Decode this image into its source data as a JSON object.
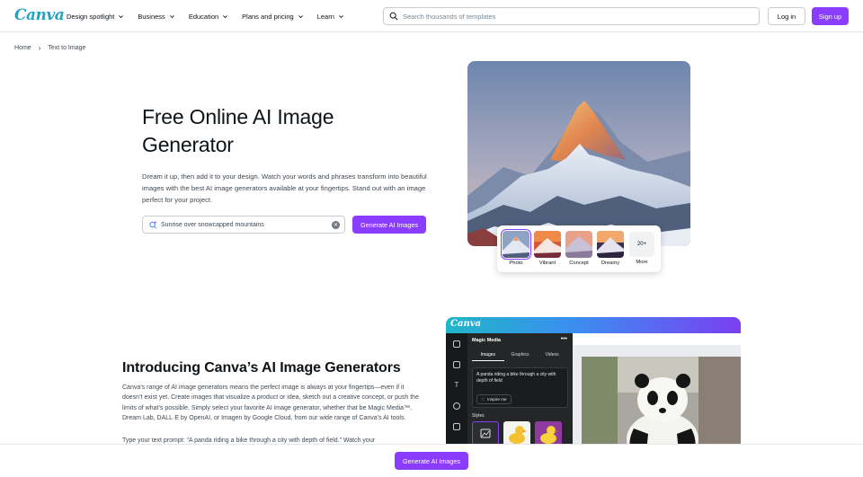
{
  "nav": {
    "logo": "Canva",
    "menu": [
      {
        "label": "Design spotlight"
      },
      {
        "label": "Business"
      },
      {
        "label": "Education"
      },
      {
        "label": "Plans and pricing"
      },
      {
        "label": "Learn"
      }
    ],
    "search_placeholder": "Search thousands of templates",
    "login_label": "Log in",
    "signup_label": "Sign up"
  },
  "breadcrumb": {
    "home": "Home",
    "current": "Text to Image"
  },
  "hero": {
    "title": "Free Online AI Image Generator",
    "description": "Dream it up, then add it to your design. Watch your words and phrases transform into beautiful images with the best AI image generators available at your fingertips. Stand out with an image perfect for your project.",
    "prompt_value": "Sunrise over snowcapped mountains",
    "generate_label": "Generate AI Images",
    "styles": [
      {
        "label": "Photo",
        "selected": true
      },
      {
        "label": "Vibrant",
        "selected": false
      },
      {
        "label": "Concept",
        "selected": false
      },
      {
        "label": "Dreamy",
        "selected": false
      },
      {
        "label": "More",
        "badge": "20+",
        "selected": false
      }
    ]
  },
  "intro": {
    "title": "Introducing Canva’s AI Image Generators",
    "paragraph": "Canva’s range of AI image generators means the perfect image is always at your fingertips—even if it doesn’t exist yet. Create images that visualize a product or idea, sketch out a creative concept, or push the limits of what’s possible. Simply select your favorite AI image generator, whether that be Magic Media™, Dream Lab, DALL·E by OpenAI, or Imagen by Google Cloud, from our wide range of Canva’s AI tools.",
    "paragraph2": "Type your text prompt: “A panda riding a bike through a city with depth of field.” Watch your"
  },
  "editor": {
    "logo": "Canva",
    "panel_title": "Magic Media",
    "menu_dots": "•••",
    "tabs": [
      {
        "label": "Images",
        "active": true
      },
      {
        "label": "Graphics",
        "active": false
      },
      {
        "label": "Videos",
        "active": false
      }
    ],
    "prompt_text": "A panda riding a bike through a city with depth of field",
    "inspire_label": "Inspire me",
    "styles_label": "Styles"
  },
  "sticky": {
    "generate_label": "Generate AI Images"
  },
  "colors": {
    "brand": "#8b3dff",
    "logo": "#23a3c4",
    "text": "#0e1318",
    "muted": "#404952"
  }
}
